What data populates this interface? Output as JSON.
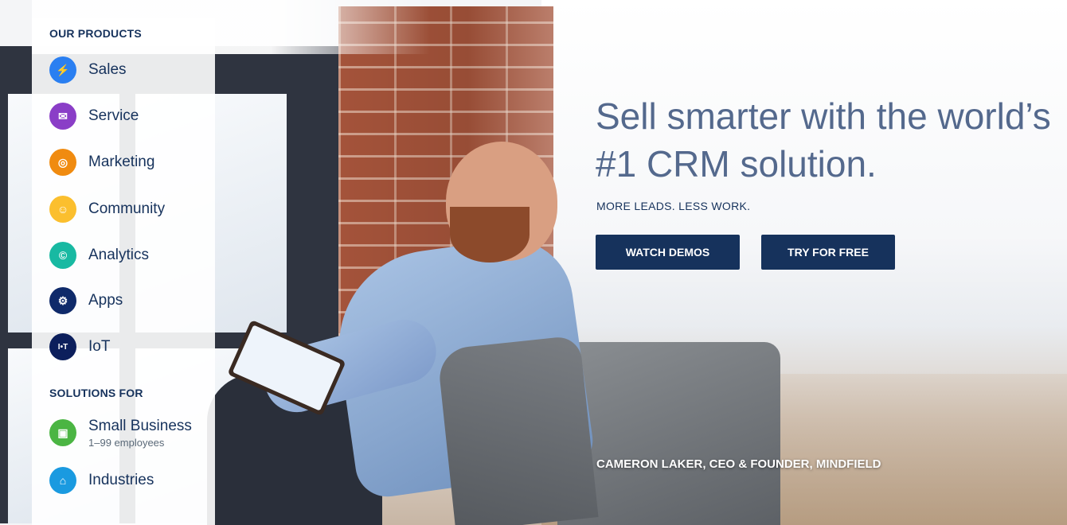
{
  "sidebar": {
    "products_heading": "OUR PRODUCTS",
    "products": [
      {
        "label": "Sales",
        "icon": "phone-bolt-icon",
        "color": "#2a7ff1",
        "glyph": "⚡"
      },
      {
        "label": "Service",
        "icon": "chat-bubble-icon",
        "color": "#8a3ec7",
        "glyph": "✉"
      },
      {
        "label": "Marketing",
        "icon": "location-pin-icon",
        "color": "#f08b10",
        "glyph": "◎"
      },
      {
        "label": "Community",
        "icon": "people-icon",
        "color": "#fbbf2e",
        "glyph": "☺"
      },
      {
        "label": "Analytics",
        "icon": "analytics-swirl-icon",
        "color": "#18b9a2",
        "glyph": "©"
      },
      {
        "label": "Apps",
        "icon": "gear-compass-icon",
        "color": "#0f2a6a",
        "glyph": "⚙"
      },
      {
        "label": "IoT",
        "icon": "iot-device-icon",
        "color": "#0c1f5c",
        "glyph": "I•T"
      }
    ],
    "solutions_heading": "SOLUTIONS FOR",
    "solutions": [
      {
        "label": "Small Business",
        "sub": "1–99 employees",
        "icon": "storefront-icon",
        "color": "#4bb543",
        "glyph": "▣"
      },
      {
        "label": "Industries",
        "icon": "industry-building-icon",
        "color": "#1a9ae0",
        "glyph": "⌂"
      }
    ]
  },
  "hero": {
    "title": "Sell smarter with the world’s #1 CRM solution.",
    "subtitle": "MORE LEADS. LESS WORK.",
    "watch_demos": "WATCH DEMOS",
    "try_free": "TRY FOR FREE",
    "caption": "CAMERON LAKER, CEO & FOUNDER, MINDFIELD"
  },
  "colors": {
    "navy": "#16325c",
    "title_gray": "#54698d"
  }
}
